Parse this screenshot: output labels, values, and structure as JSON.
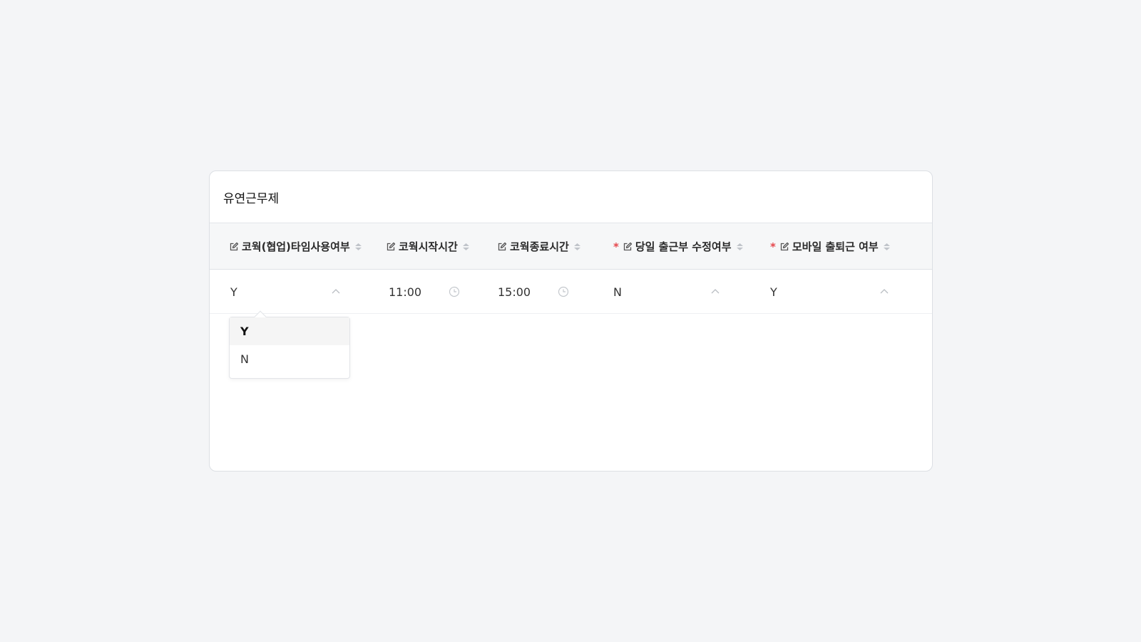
{
  "panel": {
    "title": "유연근무제"
  },
  "table": {
    "columns": [
      {
        "label": "코웍(협업)타임사용여부",
        "required": false
      },
      {
        "label": "코웍시작시간",
        "required": false
      },
      {
        "label": "코웍종료시간",
        "required": false
      },
      {
        "label": "당일 출근부 수정여부",
        "required": true
      },
      {
        "label": "모바일 출퇴근 여부",
        "required": true
      }
    ],
    "required_mark": "*",
    "row": {
      "cowork_use": "Y",
      "cowork_start": "11:00",
      "cowork_end": "15:00",
      "same_day_edit": "N",
      "mobile_commute": "Y"
    }
  },
  "dropdown": {
    "options": [
      "Y",
      "N"
    ],
    "selected": "Y"
  },
  "colors": {
    "required": "#e5484d",
    "header_bg": "#f6f7f8",
    "page_bg": "#f4f5f7"
  },
  "icons": {
    "edit": "edit-icon",
    "sort": "sort-icon",
    "chevron": "chevron-up-icon",
    "clock": "clock-icon"
  }
}
